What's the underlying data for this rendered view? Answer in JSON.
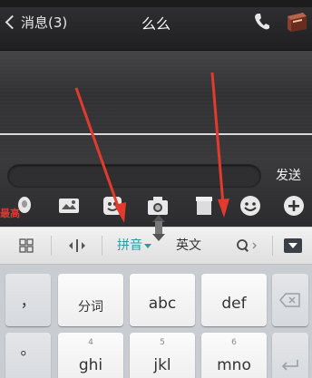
{
  "header": {
    "back_label": "消息(3)",
    "title": "么么"
  },
  "input": {
    "send_label": "发送"
  },
  "toolbar": {
    "recent_label": "最高"
  },
  "ime": {
    "mode_label": "拼音",
    "english_label": "英文"
  },
  "keyboard": {
    "rows": [
      {
        "side": "，",
        "keys": [
          {
            "num": "",
            "label": "分词"
          },
          {
            "num": "",
            "label": "abc"
          },
          {
            "num": "",
            "label": "def"
          }
        ]
      },
      {
        "side": "。",
        "keys": [
          {
            "num": "4",
            "label": "ghi"
          },
          {
            "num": "5",
            "label": "jkl"
          },
          {
            "num": "6",
            "label": "mno"
          }
        ]
      }
    ]
  },
  "colors": {
    "accent": "#2a9d9f",
    "arrow": "#e23a2c",
    "recent_label": "#d93a2f"
  },
  "icons": {
    "back": "chevron-left-icon",
    "phone": "phone-icon",
    "contact": "contact-book-icon",
    "voice": "voice-icon",
    "image": "image-icon",
    "emoji_box": "sticker-icon",
    "camera": "camera-icon",
    "gift": "box-icon",
    "smiley": "smiley-icon",
    "add": "plus-icon",
    "grid": "grid-icon",
    "cursor": "cursor-move-icon",
    "search": "search-icon",
    "hide": "hide-keyboard-icon",
    "delete": "backspace-icon",
    "enter": "enter-icon"
  }
}
